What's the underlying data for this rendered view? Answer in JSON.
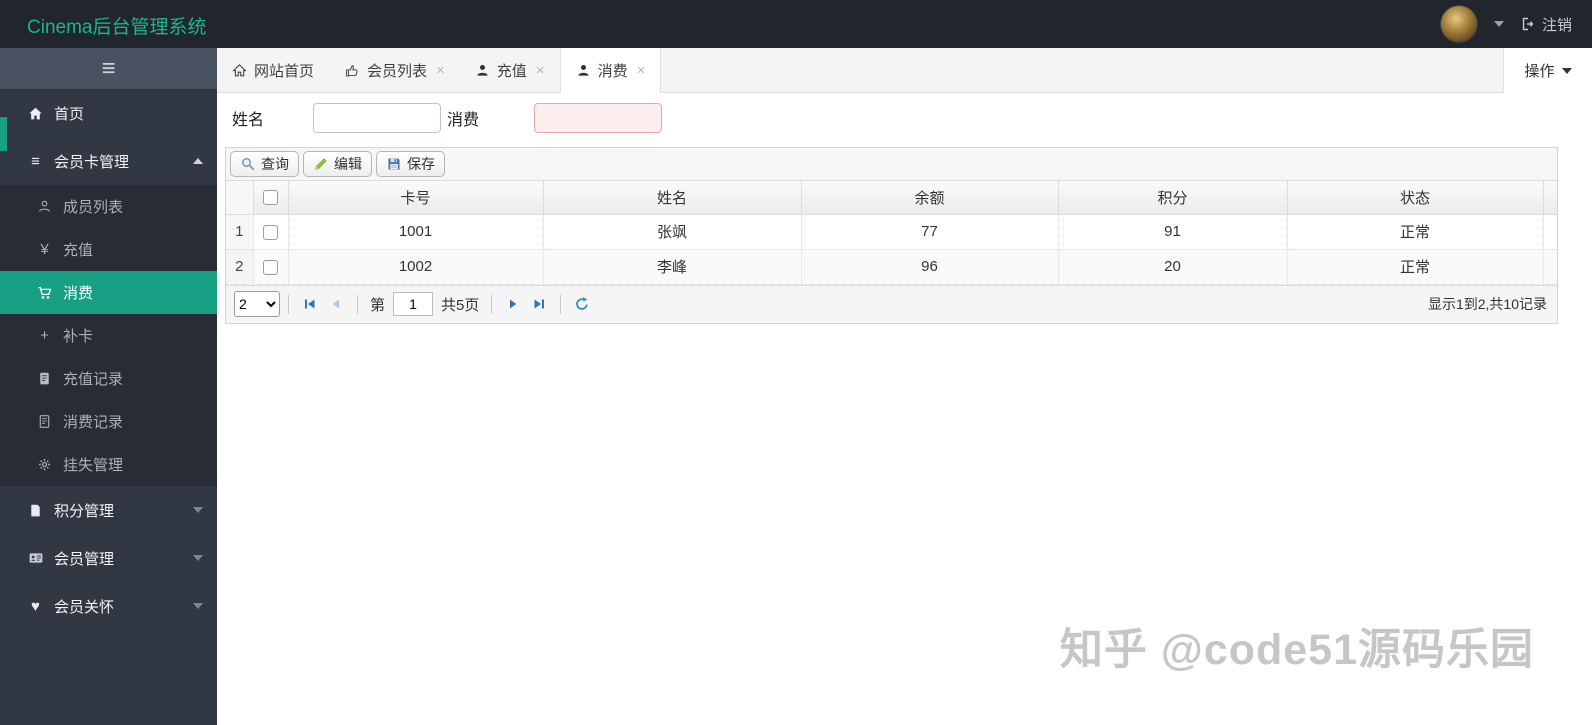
{
  "navbar": {
    "title": "Cinema后台管理系统",
    "logout_label": "注销"
  },
  "colors": {
    "accent": "#18a085",
    "title": "#1cb394",
    "navbar_bg": "#21252c",
    "invalid_input_border": "#e9a8a8"
  },
  "icons": {
    "hamburger": "≡",
    "close": "×",
    "yen": "¥",
    "plus": "+",
    "heart": "♥"
  },
  "sidebar": {
    "items": [
      {
        "label": "首页",
        "icon": "home-icon"
      },
      {
        "label": "会员卡管理",
        "icon": "list-icon",
        "state": "expanded"
      },
      {
        "label": "成员列表",
        "icon": "user-outline-icon"
      },
      {
        "label": "充值",
        "icon": "yen-icon"
      },
      {
        "label": "消费",
        "icon": "cart-icon",
        "active": true
      },
      {
        "label": "补卡",
        "icon": "plus-icon"
      },
      {
        "label": "充值记录",
        "icon": "file-icon"
      },
      {
        "label": "消费记录",
        "icon": "file-icon"
      },
      {
        "label": "挂失管理",
        "icon": "gear-icon"
      },
      {
        "label": "积分管理",
        "icon": "file-icon",
        "state": "collapsed"
      },
      {
        "label": "会员管理",
        "icon": "idcard-icon",
        "state": "collapsed"
      },
      {
        "label": "会员关怀",
        "icon": "heart-icon",
        "state": "collapsed"
      }
    ]
  },
  "tabs": [
    {
      "label": "网站首页",
      "icon": "home-icon",
      "closable": false
    },
    {
      "label": "会员列表",
      "icon": "thumbs-up-icon",
      "closable": true
    },
    {
      "label": "充值",
      "icon": "user-icon",
      "closable": true
    },
    {
      "label": "消费",
      "icon": "user-icon",
      "closable": true,
      "active": true
    }
  ],
  "actions": {
    "label": "操作"
  },
  "form": {
    "name_label": "姓名",
    "name_value": "",
    "consume_label": "消费",
    "consume_value": ""
  },
  "toolbar": {
    "search_label": "查询",
    "edit_label": "编辑",
    "save_label": "保存"
  },
  "table": {
    "columns": [
      "卡号",
      "姓名",
      "余额",
      "积分",
      "状态"
    ],
    "rows": [
      {
        "num": "1",
        "cells": [
          "1001",
          "张飒",
          "77",
          "91",
          "正常"
        ]
      },
      {
        "num": "2",
        "cells": [
          "1002",
          "李峰",
          "96",
          "20",
          "正常"
        ]
      }
    ]
  },
  "pagination": {
    "page_size": "2",
    "page_word": "第",
    "page_value": "1",
    "total_pages_label": "共5页",
    "summary": "显示1到2,共10记录"
  },
  "watermark": "知乎 @code51源码乐园"
}
